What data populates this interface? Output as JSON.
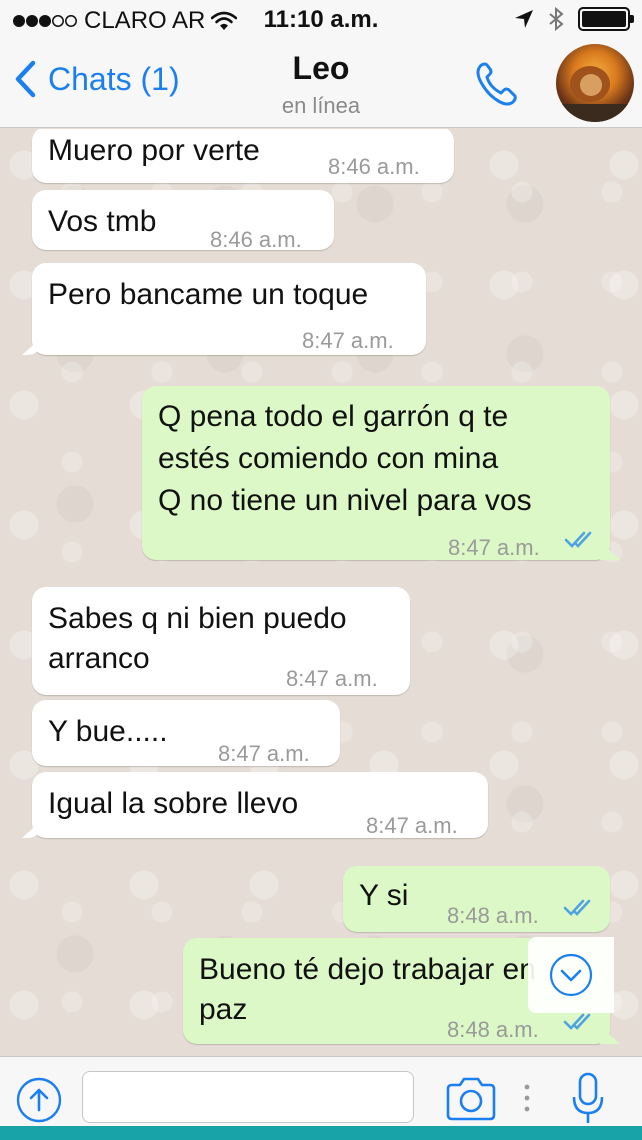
{
  "status_bar": {
    "carrier": "CLARO AR",
    "time": "11:10 a.m."
  },
  "header": {
    "back_label": "Chats (1)",
    "contact_name": "Leo",
    "contact_status": "en línea"
  },
  "messages": [
    {
      "direction": "in",
      "text": "Muero por verte",
      "time": "8:46 a.m."
    },
    {
      "direction": "in",
      "text": "Vos tmb",
      "time": "8:46 a.m."
    },
    {
      "direction": "in",
      "text": "Pero bancame un toque",
      "time": "8:47 a.m."
    },
    {
      "direction": "out",
      "text": "Q pena todo el garrón q te\nestés comiendo con mina\nQ no tiene un nivel para vos",
      "time": "8:47 a.m.",
      "read": true
    },
    {
      "direction": "in",
      "text": "Sabes q ni bien puedo\narranco",
      "time": "8:47 a.m."
    },
    {
      "direction": "in",
      "text": "Y bue.....",
      "time": "8:47 a.m."
    },
    {
      "direction": "in",
      "text": "Igual la sobre llevo",
      "time": "8:47 a.m."
    },
    {
      "direction": "out",
      "text": "Y si",
      "time": "8:48 a.m.",
      "read": true
    },
    {
      "direction": "out",
      "text": "Bueno té dejo trabajar en\npaz",
      "time": "8:48 a.m.",
      "read": true
    }
  ],
  "input": {
    "value": "",
    "placeholder": ""
  },
  "colors": {
    "accent": "#1b7ff0",
    "outgoing_bubble": "#dcf8c6",
    "incoming_bubble": "#ffffff",
    "chat_background": "#e5ddd5",
    "read_ticks": "#4fa3e0"
  },
  "icons": [
    "signal-dots-icon",
    "wifi-icon",
    "location-arrow-icon",
    "bluetooth-icon",
    "battery-icon",
    "back-chevron-icon",
    "phone-icon",
    "scroll-down-icon",
    "attach-plus-icon",
    "camera-icon",
    "microphone-icon",
    "read-ticks-icon"
  ]
}
